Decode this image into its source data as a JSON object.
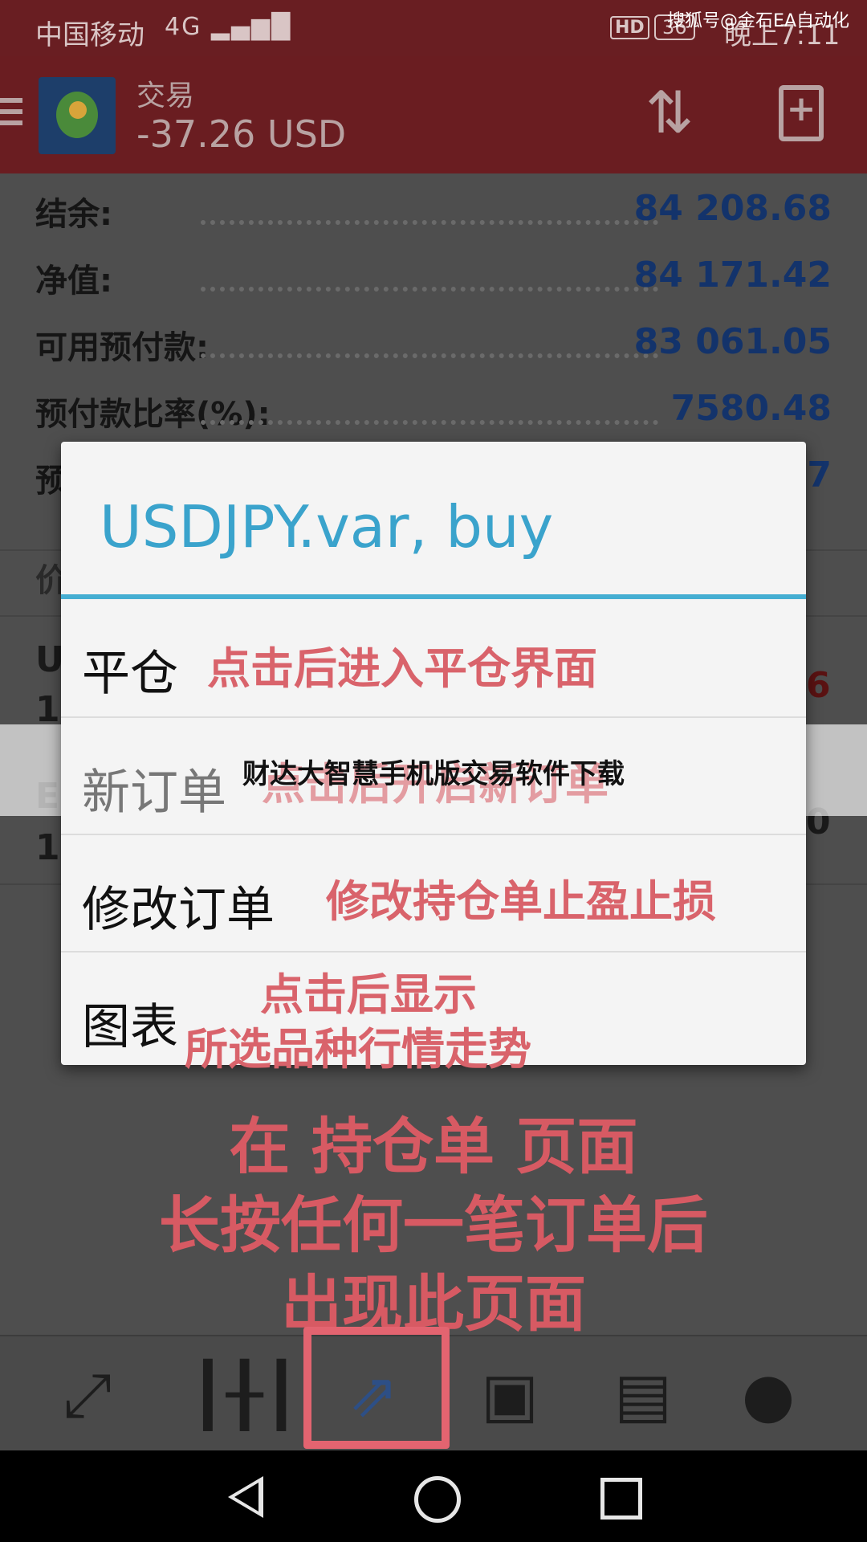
{
  "status_bar": {
    "carrier": "中国移动",
    "signal": "4G",
    "hd": "HD",
    "battery": "36",
    "time": "晚上7:11",
    "watermark": "搜狐号@金石EA自动化"
  },
  "toolbar": {
    "title": "交易",
    "balance": "-37.26 USD"
  },
  "account": [
    {
      "label": "结余:",
      "value": "84 208.68"
    },
    {
      "label": "净值:",
      "value": "84 171.42"
    },
    {
      "label": "可用预付款:",
      "value": "83 061.05"
    },
    {
      "label": "预付款比率(%):",
      "value": "7580.48"
    }
  ],
  "background_fragments": {
    "row5_label": "预",
    "row5_value": "7",
    "section": "价",
    "pos1_sym": "U",
    "pos1_line2": "1",
    "pos1_value": "6",
    "pos2_sym": "E",
    "pos2_line2": "1",
    "pos2_value": "0"
  },
  "dialog": {
    "title": "USDJPY.var, buy",
    "items": [
      {
        "label": "平仓",
        "note": "点击后进入平仓界面"
      },
      {
        "label": "新订单",
        "note": "点击后开启新订单"
      },
      {
        "label": "修改订单",
        "note": "修改持仓单止盈止损"
      },
      {
        "label": "图表",
        "note_line1": "点击后显示",
        "note_line2": "所选品种行情走势"
      }
    ]
  },
  "banner": "财达大智慧手机版交易软件下载",
  "annotation": {
    "line1": "在 持仓单 页面",
    "line2": "长按任何一笔订单后",
    "line3": "出现此页面"
  },
  "icons": {
    "nav": [
      "arrows-icon",
      "candlestick-icon",
      "trade-icon",
      "inbox-icon",
      "news-icon",
      "chat-icon"
    ],
    "highlight_color": "#e36470",
    "accent_color": "#3aa3cc",
    "note_color": "#d9636b"
  }
}
